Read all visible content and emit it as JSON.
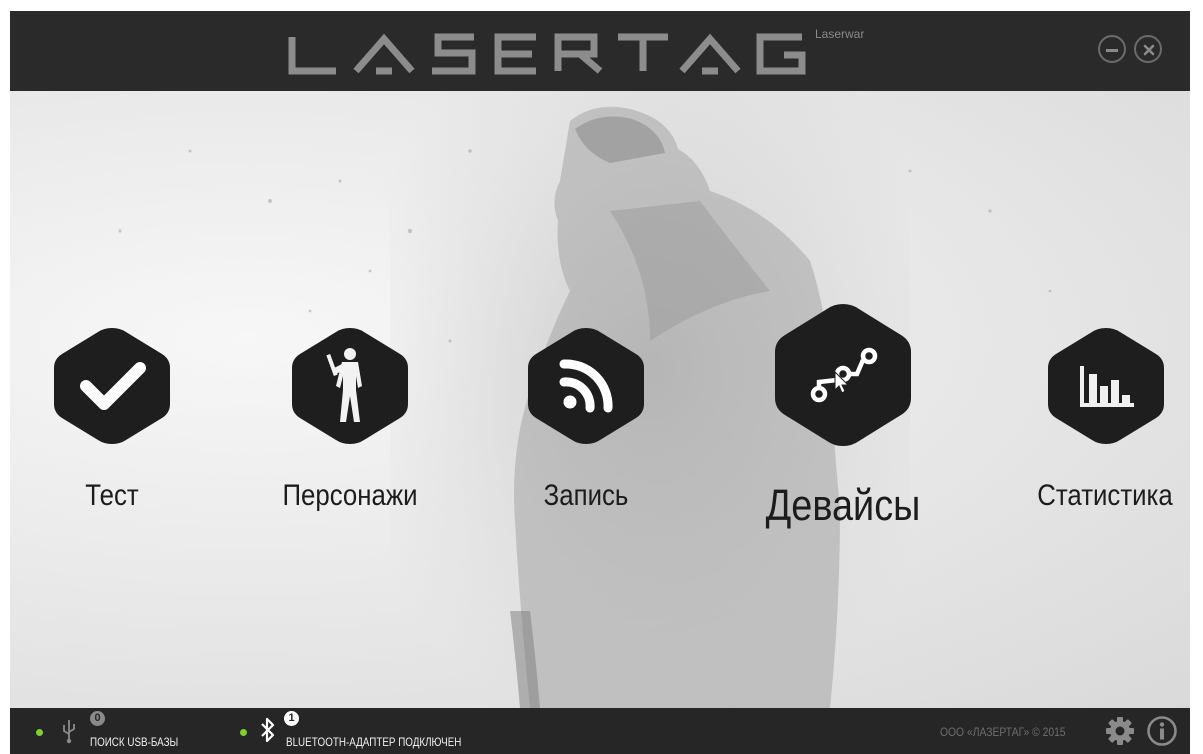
{
  "header": {
    "logo_text": "LASERTAG",
    "logo_sub": "Laserwar",
    "minimize_icon": "minimize-circle-icon",
    "close_icon": "close-circle-icon"
  },
  "menu": [
    {
      "label": "Тест",
      "icon": "check-icon",
      "active": false
    },
    {
      "label": "Персонажи",
      "icon": "soldier-icon",
      "active": false
    },
    {
      "label": "Запись",
      "icon": "rss-icon",
      "active": false
    },
    {
      "label": "Девайсы",
      "icon": "devices-chain-icon",
      "active": true
    },
    {
      "label": "Статистика",
      "icon": "bar-chart-icon",
      "active": false
    }
  ],
  "status": {
    "usb": {
      "count": "0",
      "label": "ПОИСК USB-БАЗЫ",
      "icon": "usb-icon"
    },
    "bluetooth": {
      "count": "1",
      "label": "BLUETOOTH-АДАПТЕР ПОДКЛЮЧЕН",
      "icon": "bluetooth-icon"
    },
    "copyright": "ООО «ЛАЗЕРТАГ» © 2015",
    "settings_icon": "gear-icon",
    "info_icon": "info-icon"
  },
  "colors": {
    "titlebar": "#2a2a2a",
    "statusbar": "#262626",
    "hex_fill": "#1e1e1e",
    "status_ok": "#7fd12c"
  }
}
